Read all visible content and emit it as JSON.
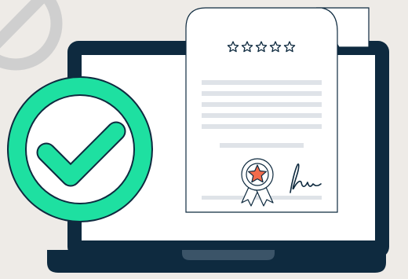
{
  "illustration": {
    "rating_stars": 5,
    "icons": {
      "prohibited": "prohibited-icon",
      "check": "checkmark-icon",
      "badge": "award-ribbon-icon",
      "signature": "signature-icon",
      "laptop": "laptop-icon",
      "certificate": "certificate-document-icon"
    },
    "colors": {
      "background": "#eeebe7",
      "laptop_frame": "#0e2a3f",
      "screen": "#ffffff",
      "check_green": "#1ee0a1",
      "badge_star": "#f26b4b",
      "text_lines": "#dfe3e8",
      "prohibited_gray": "#cfcfcf"
    }
  }
}
